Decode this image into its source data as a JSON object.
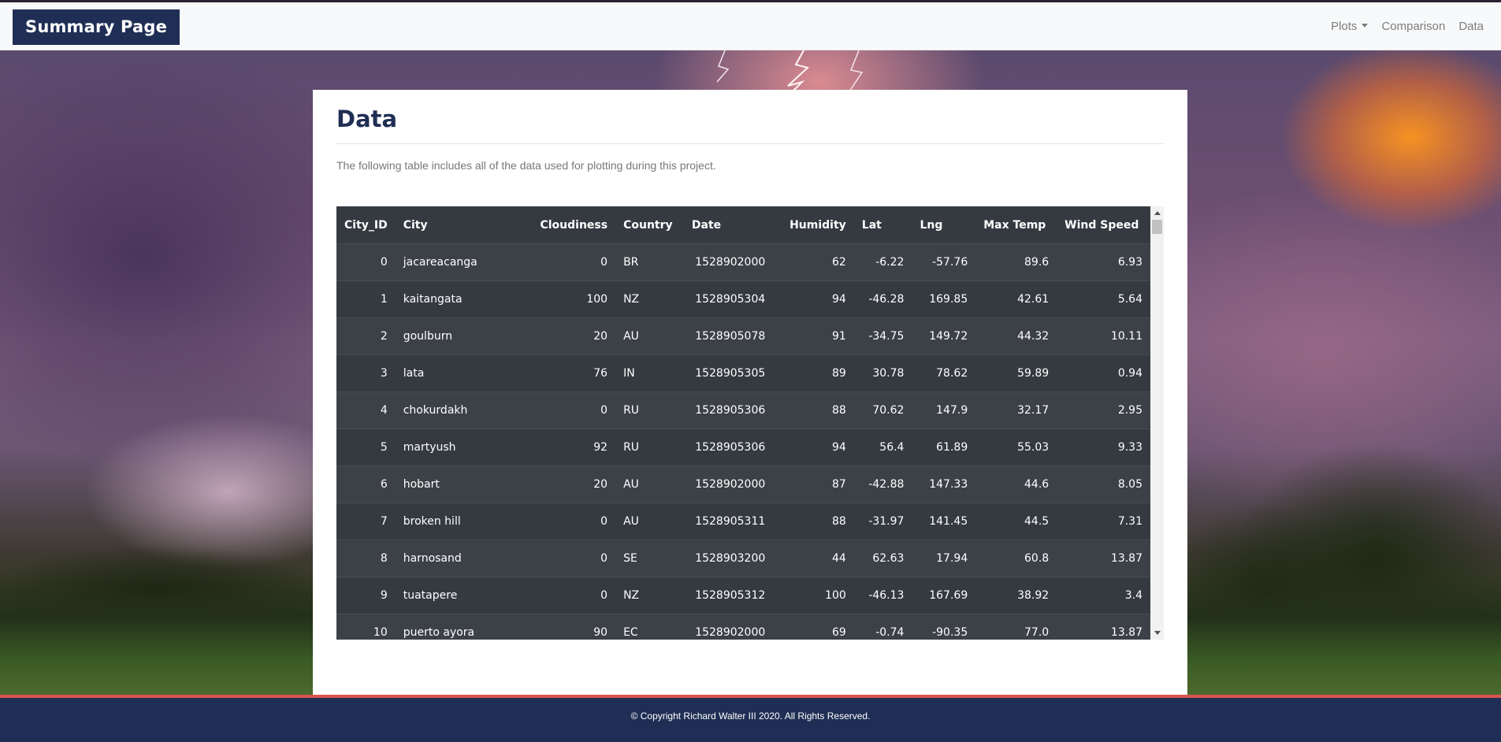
{
  "navbar": {
    "brand": "Summary Page",
    "links": [
      {
        "label": "Plots",
        "dropdown": true
      },
      {
        "label": "Comparison"
      },
      {
        "label": "Data"
      }
    ]
  },
  "main": {
    "title": "Data",
    "intro": "The following table includes all of the data used for plotting during this project.",
    "table": {
      "columns": [
        "City_ID",
        "City",
        "Cloudiness",
        "Country",
        "Date",
        "Humidity",
        "Lat",
        "Lng",
        "Max Temp",
        "Wind Speed"
      ],
      "rows": [
        [
          "0",
          "jacareacanga",
          "0",
          "BR",
          "1528902000",
          "62",
          "-6.22",
          "-57.76",
          "89.6",
          "6.93"
        ],
        [
          "1",
          "kaitangata",
          "100",
          "NZ",
          "1528905304",
          "94",
          "-46.28",
          "169.85",
          "42.61",
          "5.64"
        ],
        [
          "2",
          "goulburn",
          "20",
          "AU",
          "1528905078",
          "91",
          "-34.75",
          "149.72",
          "44.32",
          "10.11"
        ],
        [
          "3",
          "lata",
          "76",
          "IN",
          "1528905305",
          "89",
          "30.78",
          "78.62",
          "59.89",
          "0.94"
        ],
        [
          "4",
          "chokurdakh",
          "0",
          "RU",
          "1528905306",
          "88",
          "70.62",
          "147.9",
          "32.17",
          "2.95"
        ],
        [
          "5",
          "martyush",
          "92",
          "RU",
          "1528905306",
          "94",
          "56.4",
          "61.89",
          "55.03",
          "9.33"
        ],
        [
          "6",
          "hobart",
          "20",
          "AU",
          "1528902000",
          "87",
          "-42.88",
          "147.33",
          "44.6",
          "8.05"
        ],
        [
          "7",
          "broken hill",
          "0",
          "AU",
          "1528905311",
          "88",
          "-31.97",
          "141.45",
          "44.5",
          "7.31"
        ],
        [
          "8",
          "harnosand",
          "0",
          "SE",
          "1528903200",
          "44",
          "62.63",
          "17.94",
          "60.8",
          "13.87"
        ],
        [
          "9",
          "tuatapere",
          "0",
          "NZ",
          "1528905312",
          "100",
          "-46.13",
          "167.69",
          "38.92",
          "3.4"
        ],
        [
          "10",
          "puerto ayora",
          "90",
          "EC",
          "1528902000",
          "69",
          "-0.74",
          "-90.35",
          "77.0",
          "13.87"
        ]
      ]
    }
  },
  "footer": {
    "copyright": "© Copyright Richard Walter III 2020. All Rights Reserved."
  },
  "colors": {
    "brand_bg": "#1f2e54",
    "table_dark": "#343a40",
    "table_stripe": "#3c4147",
    "footer_accent": "#d9534f"
  }
}
